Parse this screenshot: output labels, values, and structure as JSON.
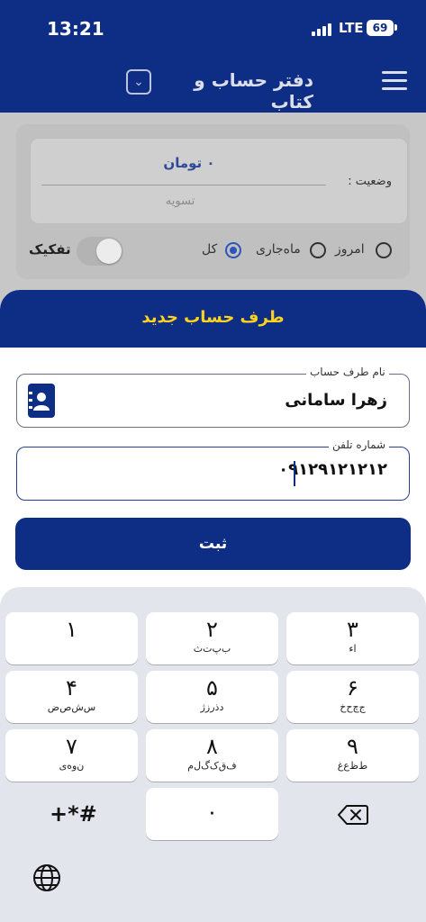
{
  "status_bar": {
    "time": "13:21",
    "network": "LTE",
    "battery": "69"
  },
  "header": {
    "title": "دفتر حساب و کتاب",
    "dropdown_icon": "chevron-down-icon",
    "menu_icon": "hamburger-menu-icon"
  },
  "background": {
    "amount": "۰ تومان",
    "status_label": "وضعیت :",
    "status_value": "تسویه",
    "filters": [
      {
        "label": "امروز",
        "selected": false
      },
      {
        "label": "ماه‌جاری",
        "selected": false
      },
      {
        "label": "کل",
        "selected": true
      }
    ],
    "split_label": "تفکیک"
  },
  "sheet": {
    "title": "طرف حساب جدید",
    "name_label": "نام طرف حساب",
    "name_value": "زهرا سامانی",
    "phone_label": "شماره تلفن",
    "phone_value": "۰۹۱۲۹۱۲۱۲۱۲",
    "submit_label": "ثبت"
  },
  "keyboard": {
    "keys": [
      {
        "num": "۱",
        "letters": ""
      },
      {
        "num": "۲",
        "letters": "ب‌پ‌ت‌ث"
      },
      {
        "num": "۳",
        "letters": "ا‌ء"
      },
      {
        "num": "۴",
        "letters": "س‌ش‌ص‌ض"
      },
      {
        "num": "۵",
        "letters": "د‌ذ‌ر‌ز‌ژ"
      },
      {
        "num": "۶",
        "letters": "ج‌چ‌ح‌خ"
      },
      {
        "num": "۷",
        "letters": "ن‌و‌ه‌ی"
      },
      {
        "num": "۸",
        "letters": "ف‌ق‌ک‌گ‌ل‌م"
      },
      {
        "num": "۹",
        "letters": "ط‌ظ‌ع‌غ"
      },
      {
        "num": "۰",
        "letters": ""
      }
    ],
    "symbols": "+*#"
  }
}
